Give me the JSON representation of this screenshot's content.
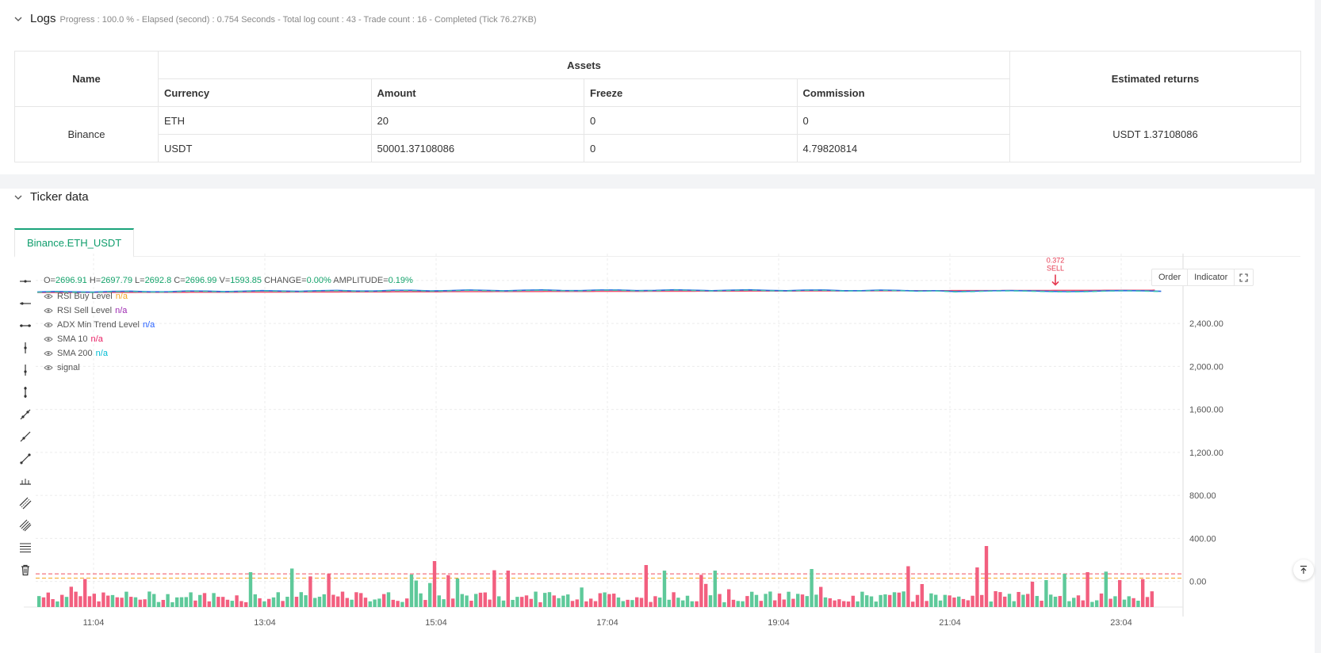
{
  "logs": {
    "title": "Logs",
    "status": "Progress : 100.0 % - Elapsed (second) : 0.754  Seconds - Total log count : 43 - Trade count : 16 - Completed (Tick 76.27KB)"
  },
  "assets_table": {
    "col_name": "Name",
    "col_assets": "Assets",
    "col_returns": "Estimated returns",
    "sub_headers": [
      "Currency",
      "Amount",
      "Freeze",
      "Commission"
    ],
    "exchange": "Binance",
    "rows": [
      {
        "currency": "ETH",
        "amount": "20",
        "freeze": "0",
        "commission": "0"
      },
      {
        "currency": "USDT",
        "amount": "50001.37108086",
        "freeze": "0",
        "commission": "4.79820814"
      }
    ],
    "returns": "USDT 1.37108086"
  },
  "ticker": {
    "title": "Ticker data",
    "tab": "Binance.ETH_USDT",
    "buttons": {
      "order": "Order",
      "indicator": "Indicator"
    },
    "ohlc": {
      "o_label": "O=",
      "o": "2696.91",
      "h_label": "H=",
      "h": "2697.79",
      "l_label": "L=",
      "l": "2692.8",
      "c_label": "C=",
      "c": "2696.99",
      "v_label": "V=",
      "v": "1593.85",
      "change_label": "CHANGE=",
      "change": "0.00%",
      "amp_label": "AMPLITUDE=",
      "amp": "0.19%"
    },
    "legend": [
      {
        "name": "RSI Buy Level",
        "value": "n/a",
        "color": "#f5a623"
      },
      {
        "name": "RSI Sell Level",
        "value": "n/a",
        "color": "#9c27b0"
      },
      {
        "name": "ADX Min Trend Level",
        "value": "n/a",
        "color": "#2962ff"
      },
      {
        "name": "SMA 10",
        "value": "n/a",
        "color": "#e91e63"
      },
      {
        "name": "SMA 200",
        "value": "n/a",
        "color": "#00bcd4"
      },
      {
        "name": "signal",
        "value": "",
        "color": "#888888"
      }
    ],
    "tools": [
      "horizontal-line-icon",
      "horizontal-ray-icon",
      "horizontal-segment-icon",
      "vertical-line-icon",
      "vertical-segment-icon",
      "vertical-ray-icon",
      "trend-line-icon",
      "ray-line-icon",
      "segment-line-icon",
      "price-range-icon",
      "parallel-channel-icon",
      "multi-channel-icon",
      "fib-levels-icon",
      "trash-icon"
    ]
  },
  "chart_data": {
    "type": "candlestick",
    "y_ticks": [
      "2,800.00",
      "2,400.00",
      "2,000.00",
      "1,600.00",
      "1,200.00",
      "800.00",
      "400.00",
      "0.00"
    ],
    "y_tick_values": [
      2800,
      2400,
      2000,
      1600,
      1200,
      800,
      400,
      0
    ],
    "x_ticks": [
      "11:04",
      "13:04",
      "15:04",
      "17:04",
      "19:04",
      "21:04",
      "23:04"
    ],
    "ylim": [
      -180,
      3050
    ],
    "price": {
      "start": 2693,
      "end": 2701,
      "max": 2720,
      "min": 2675
    },
    "sma200": {
      "start": 2688,
      "end": 2710
    },
    "rsi_buy_level": 30,
    "rsi_sell_level": 70,
    "annotation": {
      "text_top": "0.372",
      "text_bottom": "SELL",
      "x_label": "23:04",
      "price": 2700
    },
    "volume_peaks": [
      {
        "label": "15:04",
        "value": 430
      },
      {
        "label": "23:04",
        "value": 340
      }
    ],
    "colors": {
      "up": "#5ec99a",
      "down": "#f25f7f",
      "sma200": "#f0516d",
      "price": "#2a6ee0",
      "price_dash": "#3cc8b0",
      "grid": "#ececec"
    }
  }
}
